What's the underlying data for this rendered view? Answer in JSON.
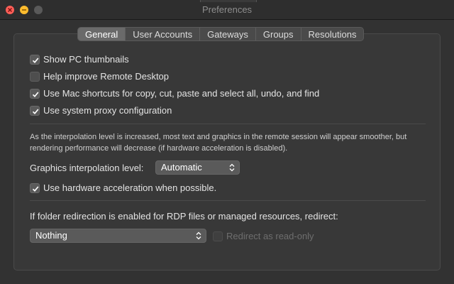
{
  "window": {
    "title": "Preferences"
  },
  "tabs": [
    {
      "label": "General",
      "active": true
    },
    {
      "label": "User Accounts",
      "active": false
    },
    {
      "label": "Gateways",
      "active": false
    },
    {
      "label": "Groups",
      "active": false
    },
    {
      "label": "Resolutions",
      "active": false
    }
  ],
  "general": {
    "show_thumbnails": {
      "label": "Show PC thumbnails",
      "checked": true
    },
    "help_improve": {
      "label": "Help improve Remote Desktop",
      "checked": false
    },
    "mac_shortcuts": {
      "label": "Use Mac shortcuts for copy, cut, paste and select all, undo, and find",
      "checked": true
    },
    "system_proxy": {
      "label": "Use system proxy configuration",
      "checked": true
    },
    "interpolation_note": "As the interpolation level is increased, most text and graphics in the remote session will appear smoother, but rendering performance will decrease (if hardware acceleration is disabled).",
    "interpolation_label": "Graphics interpolation level:",
    "interpolation_value": "Automatic",
    "hw_accel": {
      "label": "Use hardware acceleration when possible.",
      "checked": true
    },
    "redirect_label": "If folder redirection is enabled for RDP files or managed resources, redirect:",
    "redirect_value": "Nothing",
    "readonly": {
      "label": "Redirect as read-only",
      "checked": false,
      "enabled": false
    }
  },
  "colors": {
    "window_bg": "#323232",
    "panel_bg": "#383838",
    "close": "#ff5f57",
    "minimize": "#febc2e"
  },
  "icons": [
    "close-icon",
    "minimize-icon",
    "zoom-icon",
    "checkmark-icon",
    "updown-chevron-icon"
  ]
}
